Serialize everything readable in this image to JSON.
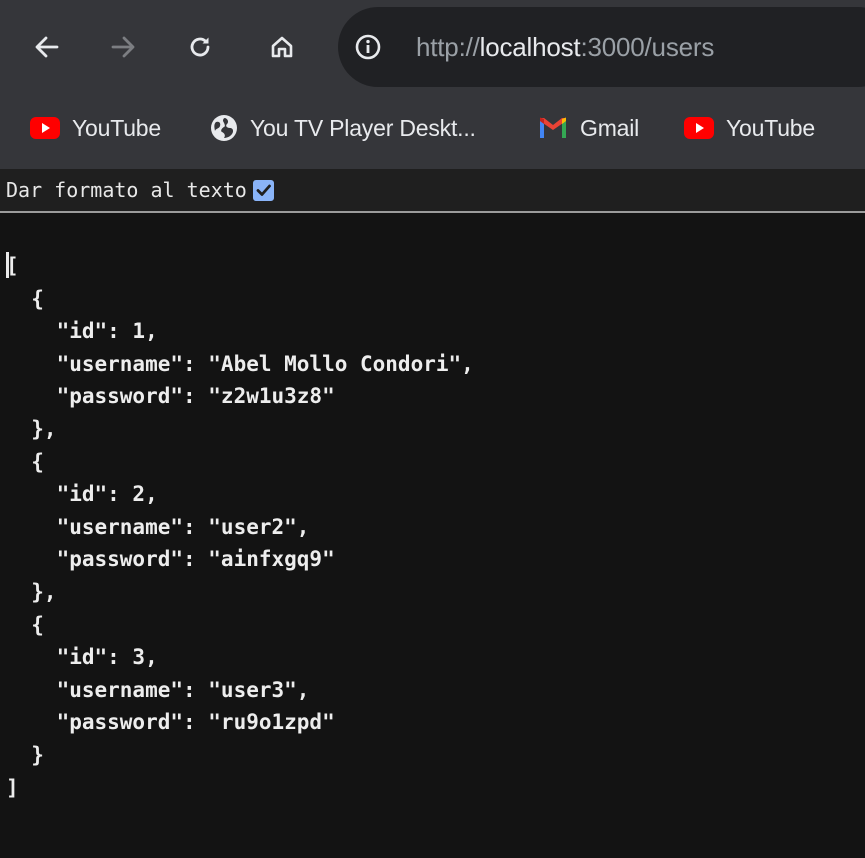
{
  "browser": {
    "url_scheme": "http://",
    "url_host": "localhost",
    "url_path": ":3000/users",
    "icons": {
      "back": "arrow-left-icon",
      "forward": "arrow-right-icon",
      "reload": "reload-icon",
      "home": "home-icon",
      "site_info": "info-icon"
    },
    "colors": {
      "toolbar_bg": "#35363a",
      "omnibox_bg": "#202124",
      "page_bg": "#131313"
    }
  },
  "bookmarks": [
    {
      "label": "YouTube",
      "icon": "youtube-icon"
    },
    {
      "label": "You TV Player Deskt...",
      "icon": "globe-icon"
    },
    {
      "label": "Gmail",
      "icon": "gmail-icon"
    },
    {
      "label": "YouTube",
      "icon": "youtube-icon"
    }
  ],
  "pretty_print": {
    "label": "Dar formato al texto",
    "checked": true
  },
  "json_lines": [
    "[",
    "  {",
    "    \"id\": 1,",
    "    \"username\": \"Abel Mollo Condori\",",
    "    \"password\": \"z2w1u3z8\"",
    "  },",
    "  {",
    "    \"id\": 2,",
    "    \"username\": \"user2\",",
    "    \"password\": \"ainfxgq9\"",
    "  },",
    "  {",
    "    \"id\": 3,",
    "    \"username\": \"user3\",",
    "    \"password\": \"ru9o1zpd\"",
    "  }",
    "]"
  ]
}
